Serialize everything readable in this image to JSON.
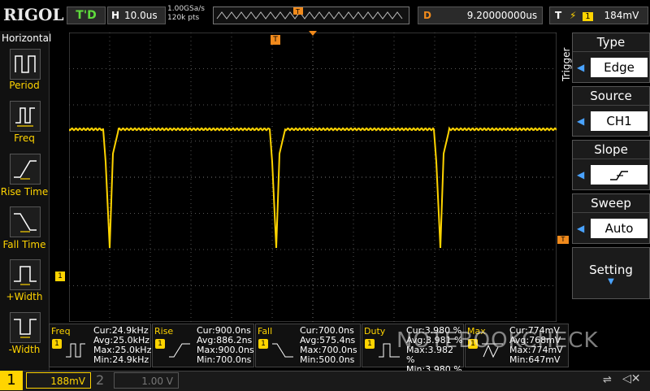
{
  "brand": "RIGOL",
  "status": {
    "run_state": "T'D",
    "timebase_letter": "H",
    "timebase": "10.0us",
    "sample_rate": "1.00GSa/s",
    "memory_depth": "120k pts"
  },
  "delay": {
    "letter": "D",
    "value": "9.20000000us"
  },
  "trigger_top": {
    "letter": "T",
    "channel": "1",
    "level": "184mV"
  },
  "left_panel": {
    "title": "Horizontal",
    "items": [
      {
        "label": "Period",
        "icon": "period-icon"
      },
      {
        "label": "Freq",
        "icon": "freq-icon"
      },
      {
        "label": "Rise Time",
        "icon": "rise-time-icon"
      },
      {
        "label": "Fall Time",
        "icon": "fall-time-icon"
      },
      {
        "label": "+Width",
        "icon": "pos-width-icon"
      },
      {
        "label": "-Width",
        "icon": "neg-width-icon"
      }
    ]
  },
  "right_menu": {
    "side_label": "Trigger",
    "items": [
      {
        "title": "Type",
        "value": "Edge"
      },
      {
        "title": "Source",
        "value": "CH1"
      },
      {
        "title": "Slope",
        "value": ""
      },
      {
        "title": "Sweep",
        "value": "Auto"
      }
    ],
    "setting_label": "Setting"
  },
  "markers": {
    "trigger_pos": "T",
    "channel_marker": "1"
  },
  "measurements": [
    {
      "name": "Freq",
      "cur": "Cur:24.9kHz",
      "avg": "Avg:25.0kHz",
      "max": "Max:25.0kHz",
      "min": "Min:24.9kHz"
    },
    {
      "name": "Rise",
      "cur": "Cur:900.0ns",
      "avg": "Avg:886.2ns",
      "max": "Max:900.0ns",
      "min": "Min:700.0ns"
    },
    {
      "name": "Fall",
      "cur": "Cur:700.0ns",
      "avg": "Avg:575.4ns",
      "max": "Max:700.0ns",
      "min": "Min:500.0ns"
    },
    {
      "name": "Duty",
      "cur": "Cur:3.980 %",
      "avg": "Avg:3.981 %",
      "max": "Max:3.982 %",
      "min": "Min:3.980 %"
    },
    {
      "name": "Max",
      "cur": "Cur:774mV",
      "avg": "Avg:768mV",
      "max": "Max:774mV",
      "min": "Min:647mV"
    }
  ],
  "bottom": {
    "ch1_label": "1",
    "ch1_scale": "188mV",
    "ch2_label": "2",
    "ch2_scale": "1.00 V"
  },
  "watermark": "NOTEBOOKCHECK",
  "colors": {
    "ch1": "#ffd400",
    "trigger": "#f08a1c",
    "running": "#5fdc3c",
    "accent": "#4aa3ff"
  }
}
